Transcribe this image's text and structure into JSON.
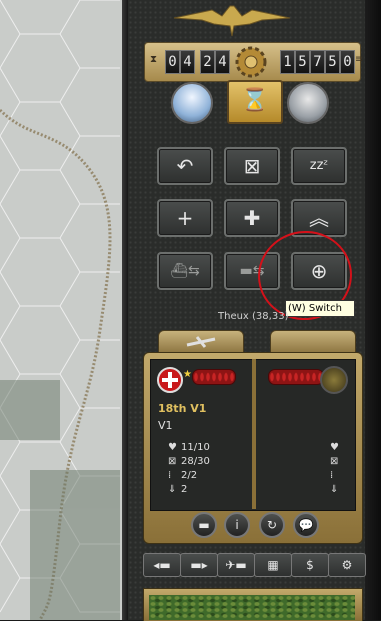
{
  "turn": {
    "current": [
      "0",
      "4"
    ],
    "max": [
      "2",
      "4"
    ]
  },
  "prestige": [
    "1",
    "5",
    "7",
    "5",
    "0"
  ],
  "buttons": {
    "row1": [
      "undo-icon",
      "next-unit-icon",
      "sleep-icon"
    ],
    "row2": [
      "reinforce-icon",
      "upgrade-icon",
      "rank-up-icon"
    ],
    "row3": [
      "embark-sea-icon",
      "embark-land-icon",
      "switch-icon"
    ]
  },
  "tooltip": "(W) Switch",
  "hex_label": "Theux (38,33)",
  "unit": {
    "name": "18th V1",
    "type": "V1",
    "stats": [
      "11/10",
      "28/30",
      "2/2",
      "2"
    ],
    "stat_icons": [
      "heart-icon",
      "ammo-icon",
      "fuel-icon",
      "arrow-icon"
    ]
  },
  "colors": {
    "accent_gold": "#c2a96b",
    "button_gray": "#4a4d4c",
    "highlight_red": "#d4111a",
    "unit_name": "#e0c060"
  }
}
